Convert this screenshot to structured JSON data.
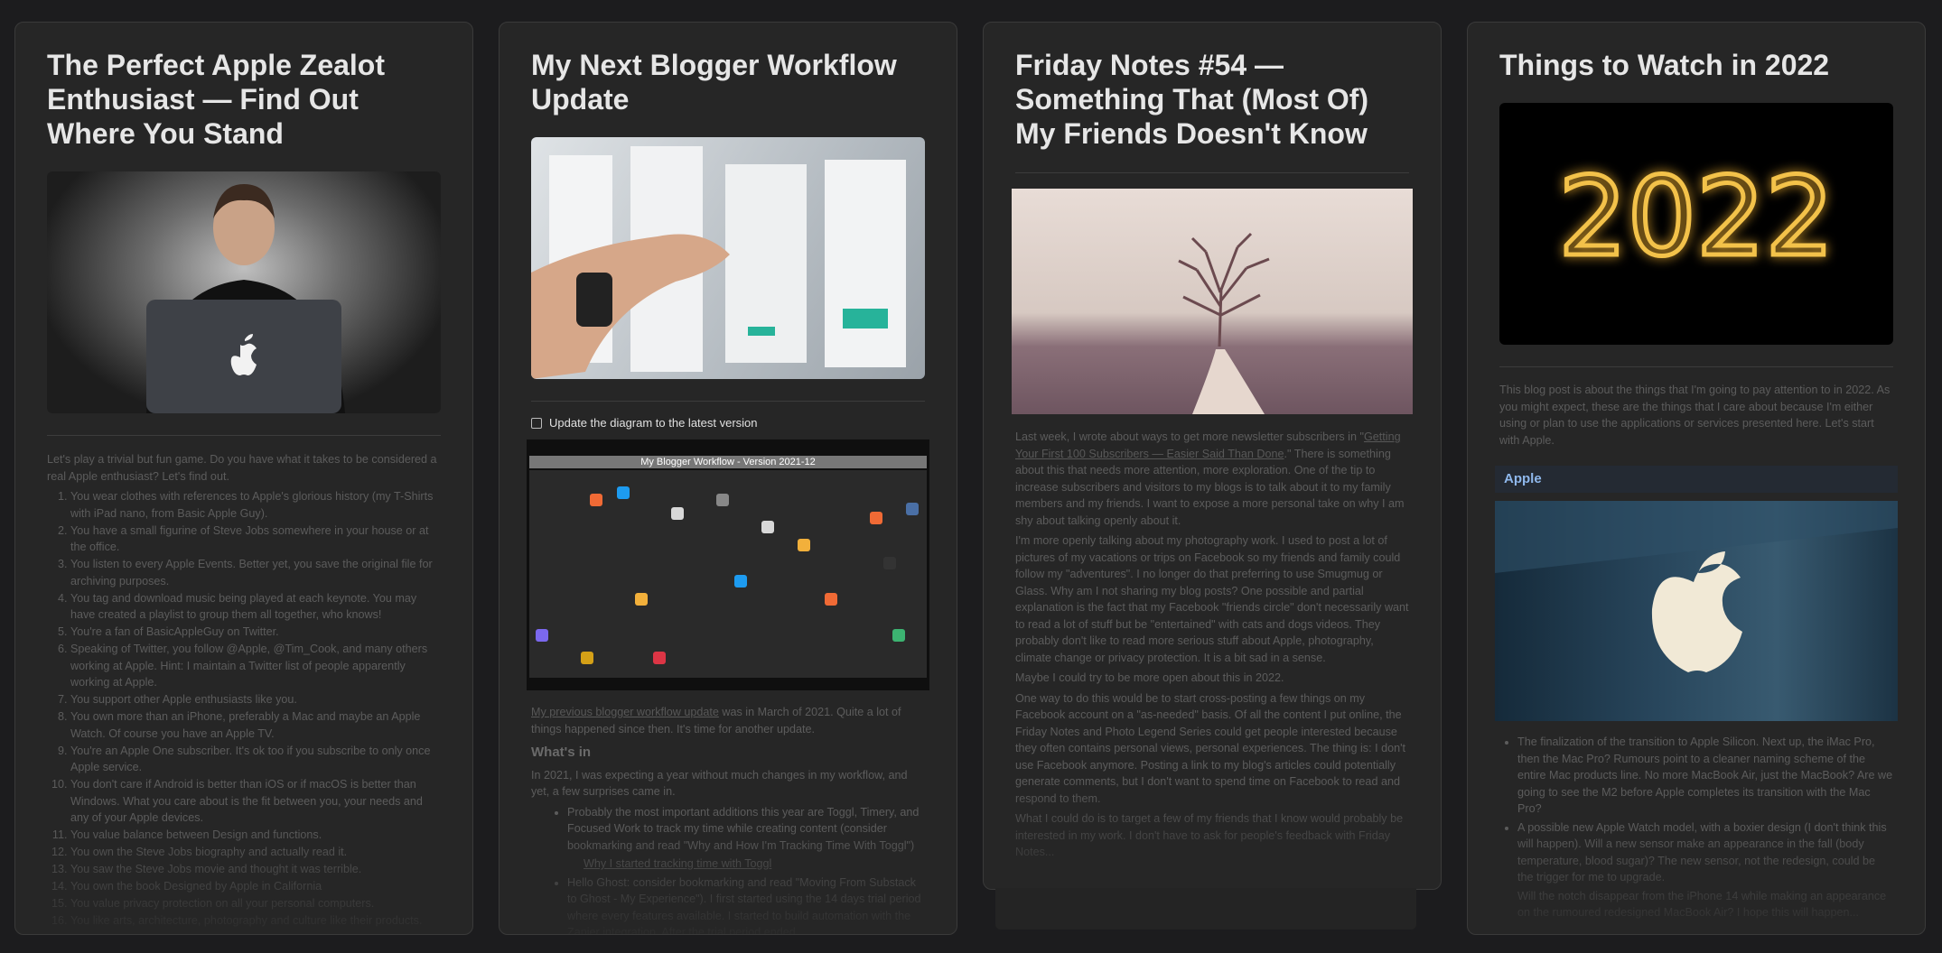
{
  "cards": [
    {
      "title": "The Perfect Apple Zealot Enthusiast — Find Out Where You Stand",
      "intro": "Let's play a trivial but fun game. Do you have what it takes to be considered a real Apple enthusiast? Let's find out.",
      "items": [
        "You wear clothes with references to Apple's glorious history (my T-Shirts with iPad nano, from Basic Apple Guy).",
        "You have a small figurine of Steve Jobs somewhere in your house or at the office.",
        "You listen to every Apple Events. Better yet, you save the original file for archiving purposes.",
        "You tag and download music being played at each keynote. You may have created a playlist to group them all together, who knows!",
        "You're a fan of BasicAppleGuy on Twitter.",
        "Speaking of Twitter, you follow @Apple, @Tim_Cook, and many others working at Apple. Hint: I maintain a Twitter list of people apparently working at Apple.",
        "You support other Apple enthusiasts like you.",
        "You own more than an iPhone, preferably a Mac and maybe an Apple Watch. Of course you have an Apple TV.",
        "You're an Apple One subscriber. It's ok too if you subscribe to only once Apple service.",
        "You don't care if Android is better than iOS or if macOS is better than Windows. What you care about is the fit between you, your needs  and any of your Apple devices.",
        "You value balance between Design and functions.",
        "You own the Steve Jobs biography and actually read it.",
        "You saw the Steve Jobs movie and thought it was terrible.",
        "You own the book Designed by Apple in California",
        "You value privacy protection on all your personal computers.",
        "You like arts, architecture, photography and culture like their products."
      ]
    },
    {
      "title": "My Next Blogger Workflow Update",
      "task": "Update the diagram to the latest version",
      "diagram_title": "My Blogger Workflow - Version 2021-12",
      "intro_link": "My previous blogger workflow update",
      "intro_rest": " was in March of 2021. Quite a lot of things happened since then. It's time for another update.",
      "heading": "What's in",
      "para": "In 2021, I was expecting a year without much changes in my workflow, and yet, a few surprises came in.",
      "bullet1": "Probably the most important additions this year are Toggl, Timery, and Focused Work to track my time while creating content (consider bookmarking and read \"Why and How I'm Tracking Time With Toggl\")",
      "bullet1_sub": "Why I started tracking time with Toggl",
      "bullet2": "Hello Ghost: consider bookmarking and read \"Moving From Substack to Ghost - My Experience\"). I first started using the 14 days trial period where every features available. I started to build automation with the Zapier integration. After the trial period ended..."
    },
    {
      "title": "Friday Notes #54 — Something That (Most Of) My Friends Doesn't Know",
      "p1_a": "Last week, I wrote about ways to get more newsletter subscribers in \"",
      "p1_link": "Getting Your First 100 Subscribers — Easier Said Than Done",
      "p1_b": ".\" There is something about this that needs more attention, more exploration. One of the tip to increase subscribers and visitors to my blogs is to talk about it to my family members and my friends. I want to expose a more personal take on why I am shy about talking openly about it.",
      "p2": "I'm more openly talking about my photography work. I used to post a lot of pictures of my vacations or trips on Facebook so my friends and family could follow my \"adventures\". I no longer do that preferring to use Smugmug or Glass. Why am I not sharing my blog posts? One possible and partial explanation is the fact that my Facebook \"friends circle\" don't necessarily want to read a lot of stuff but be \"entertained\" with cats and dogs videos. They probably don't like to read more serious stuff about Apple, photography, climate change or privacy protection. It is a bit sad in a sense.",
      "p3": "Maybe I could try to be more open about this in 2022.",
      "p4": "One way to do this would be to start cross-posting a few things on my Facebook account on a \"as-needed\" basis. Of all the content I put online, the Friday Notes and Photo Legend Series could get people interested because they often contains personal views, personal experiences. The thing is: I don't use Facebook anymore. Posting a link to my blog's articles could potentially generate comments, but I don't want to spend time on Facebook to read and respond to them.",
      "p5": "What I could do is to target a few of my friends that I know would probably be interested in my work. I don't have to ask for people's feedback with Friday Notes..."
    },
    {
      "title": "Things to Watch in 2022",
      "hero_text": "2022",
      "intro": "This blog post is about the things that I'm going to pay attention to in 2022. As you might expect, these are the things that I care about because I'm either using or plan to use the applications or services presented here. Let's start with Apple.",
      "section": "Apple",
      "b1": "The finalization of the transition to Apple Silicon. Next up, the iMac Pro, then the Mac Pro? Rumours point to a cleaner naming scheme of the entire Mac products line. No more MacBook Air, just the MacBook? Are we going to see the M2 before Apple completes its transition with the Mac Pro?",
      "b2": "A possible new Apple Watch model, with a boxier design (I don't think this will happen). Will a new sensor make an appearance in the fall (body temperature, blood sugar)? The new sensor, not the redesign, could be the trigger for me to upgrade.",
      "b3": "Will the notch disappear from the iPhone 14 while making an appearance on the rumoured redesigned MacBook Air? I hope this will happen..."
    }
  ],
  "colors": {
    "background": "#1c1c1e",
    "card": "#262626",
    "section_accent": "#8fb8ec"
  }
}
